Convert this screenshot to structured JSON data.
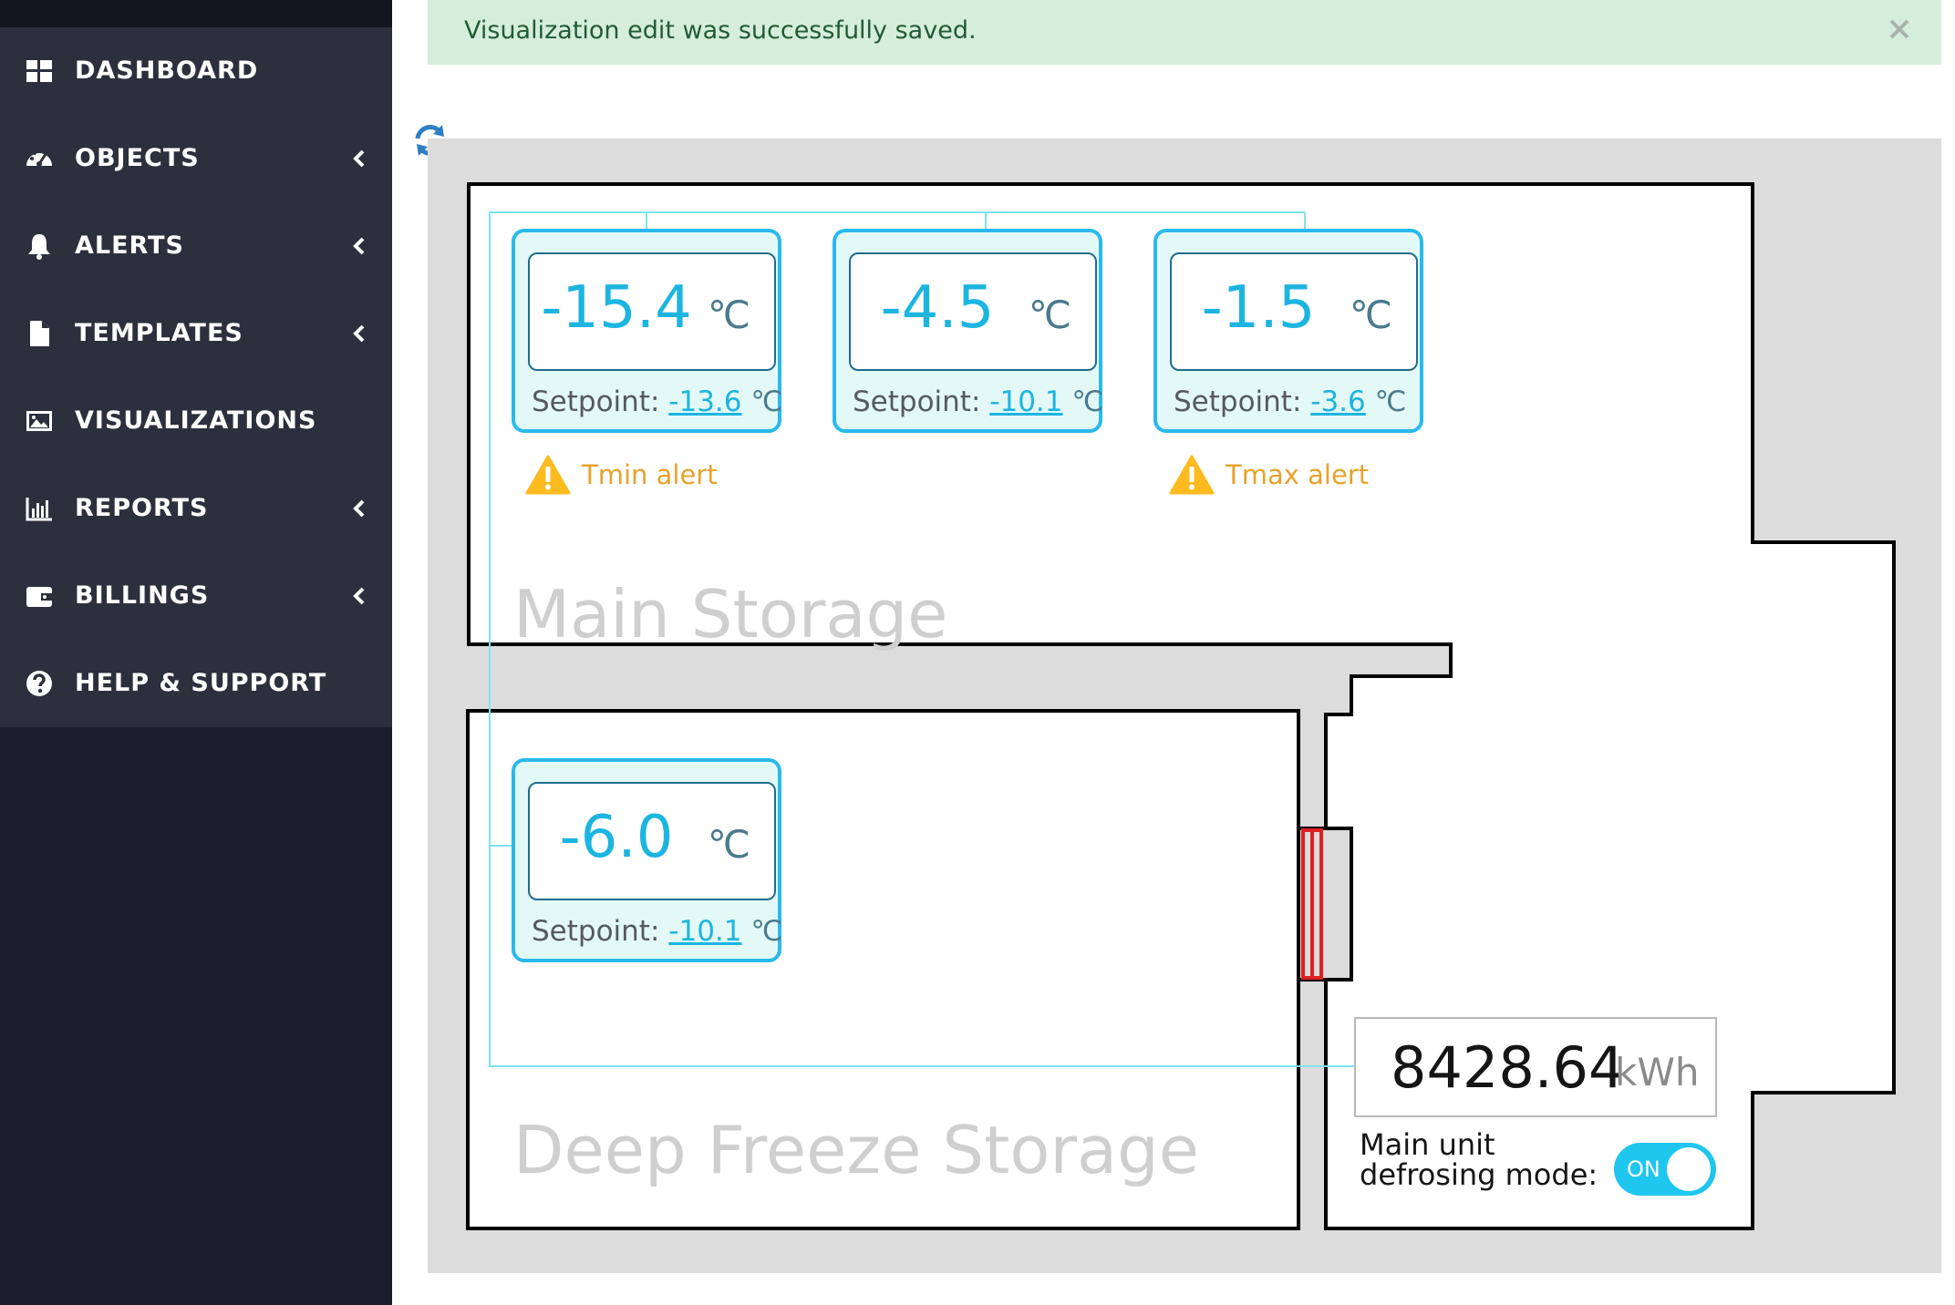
{
  "sidebar": {
    "items": [
      {
        "label": "DASHBOARD",
        "icon": "dashboard-icon",
        "has_submenu": false
      },
      {
        "label": "OBJECTS",
        "icon": "gauge-icon",
        "has_submenu": true
      },
      {
        "label": "ALERTS",
        "icon": "bell-icon",
        "has_submenu": true
      },
      {
        "label": "TEMPLATES",
        "icon": "file-icon",
        "has_submenu": true
      },
      {
        "label": "VISUALIZATIONS",
        "icon": "image-icon",
        "has_submenu": false
      },
      {
        "label": "REPORTS",
        "icon": "bar-chart-icon",
        "has_submenu": true
      },
      {
        "label": "BILLINGS",
        "icon": "wallet-icon",
        "has_submenu": true
      },
      {
        "label": "HELP & SUPPORT",
        "icon": "question-circle-icon",
        "has_submenu": false
      }
    ]
  },
  "notification": {
    "message": "Visualization edit was successfully saved.",
    "close_label": "×"
  },
  "visualization": {
    "sensors": [
      {
        "temperature": "-15.4",
        "unit": "℃",
        "setpoint_label": "Setpoint:",
        "setpoint": "-13.6",
        "setpoint_unit": "℃"
      },
      {
        "temperature": "-4.5",
        "unit": "℃",
        "setpoint_label": "Setpoint:",
        "setpoint": "-10.1",
        "setpoint_unit": "℃"
      },
      {
        "temperature": "-1.5",
        "unit": "℃",
        "setpoint_label": "Setpoint:",
        "setpoint": "-3.6",
        "setpoint_unit": "℃"
      },
      {
        "temperature": "-6.0",
        "unit": "℃",
        "setpoint_label": "Setpoint:",
        "setpoint": "-10.1",
        "setpoint_unit": "℃"
      }
    ],
    "alerts": [
      {
        "label": "Tmin alert"
      },
      {
        "label": "Tmax alert"
      }
    ],
    "rooms": [
      {
        "label": "Main Storage"
      },
      {
        "label": "Deep Freeze Storage"
      }
    ],
    "energy": {
      "value": "8428.64",
      "unit": "kWh"
    },
    "defrost": {
      "label": "Main unit defrosing mode:",
      "toggle_text": "ON",
      "state": true
    }
  },
  "colors": {
    "accent": "#1cb5e0",
    "sidebar_bg": "#1b1e2b",
    "menu_bg": "#2c2f3c",
    "alert_bg": "#d4eedb",
    "warning": "#e8a22b",
    "door": "#e02020"
  }
}
